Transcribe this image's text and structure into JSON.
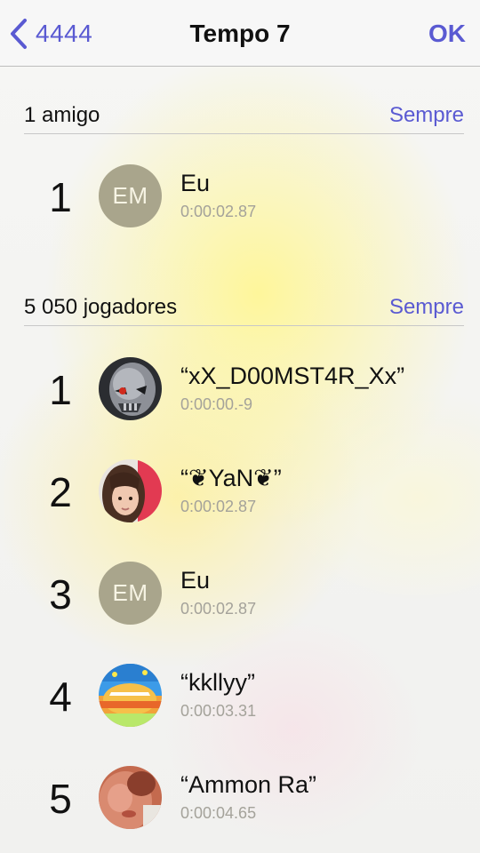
{
  "nav": {
    "back_label": "4444",
    "title": "Tempo 7",
    "ok_label": "OK"
  },
  "colors": {
    "accent": "#5a5ad2",
    "avatar_initials_bg": "#a9a58c"
  },
  "friends_section": {
    "title": "1 amigo",
    "filter_label": "Sempre",
    "rows": [
      {
        "rank": "1",
        "initials": "EM",
        "name": "Eu",
        "time": "0:00:02.87"
      }
    ]
  },
  "players_section": {
    "title": "5 050 jogadores",
    "filter_label": "Sempre",
    "rows": [
      {
        "rank": "1",
        "name": "“xX_D00MST4R_Xx”",
        "time": "0:00:00.-9",
        "avatar": "skull-photo"
      },
      {
        "rank": "2",
        "name": "“❦YaN❦”",
        "time": "0:00:02.87",
        "avatar": "girl-photo"
      },
      {
        "rank": "3",
        "initials": "EM",
        "name": "Eu",
        "time": "0:00:02.87"
      },
      {
        "rank": "4",
        "name": "“kkllyy”",
        "time": "0:00:03.31",
        "avatar": "sunset-photo"
      },
      {
        "rank": "5",
        "name": "“Ammon Ra”",
        "time": "0:00:04.65",
        "avatar": "face-photo"
      }
    ]
  }
}
